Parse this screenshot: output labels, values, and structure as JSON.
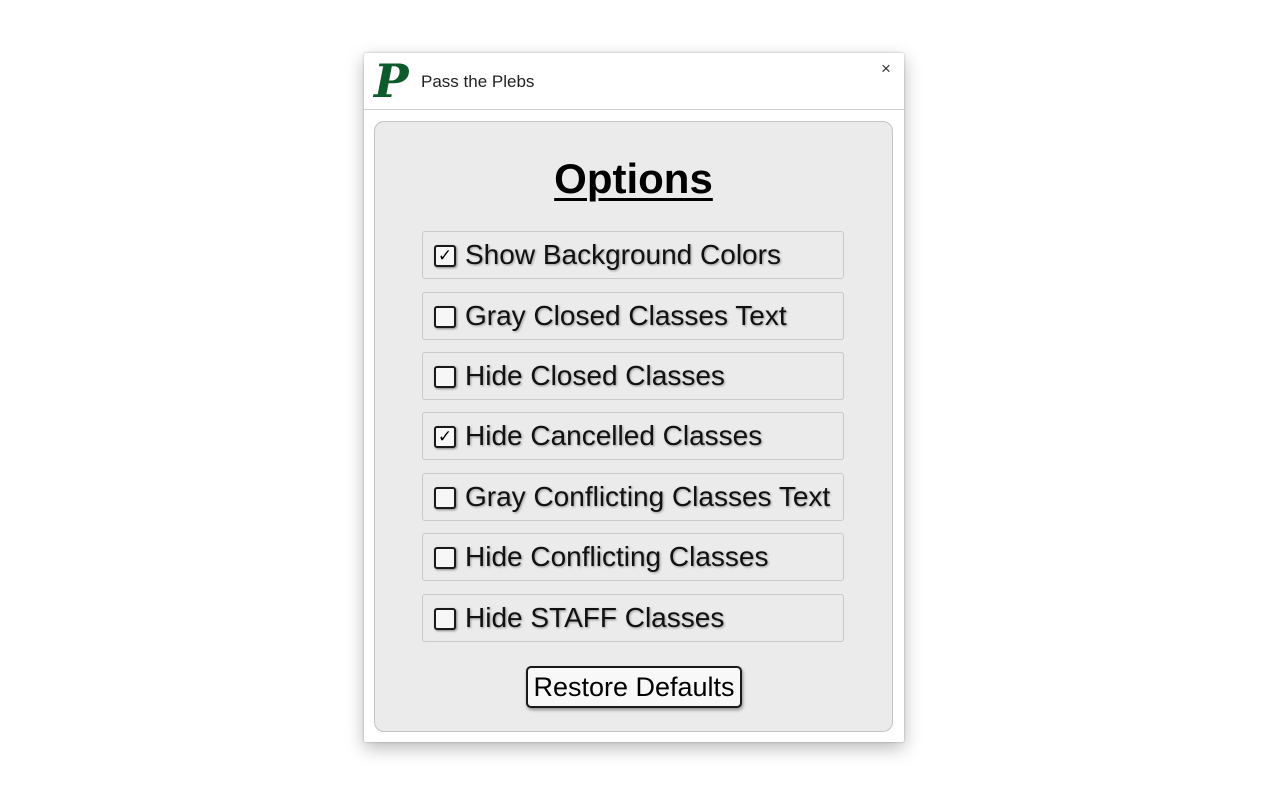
{
  "window": {
    "logo_letter": "P",
    "app_title": "Pass the Plebs",
    "close_label": "×"
  },
  "panel": {
    "title": "Options",
    "options": [
      {
        "label": "Show Background Colors",
        "checked": true,
        "mark": "✓"
      },
      {
        "label": "Gray Closed Classes Text",
        "checked": false,
        "mark": ""
      },
      {
        "label": "Hide Closed Classes",
        "checked": false,
        "mark": ""
      },
      {
        "label": "Hide Cancelled Classes",
        "checked": true,
        "mark": "✓"
      },
      {
        "label": "Gray Conflicting Classes Text",
        "checked": false,
        "mark": ""
      },
      {
        "label": "Hide Conflicting Classes",
        "checked": false,
        "mark": ""
      },
      {
        "label": "Hide STAFF Classes",
        "checked": false,
        "mark": ""
      }
    ],
    "restore_label": "Restore Defaults"
  },
  "colors": {
    "logo": "#0d5a2a",
    "panel_bg": "#ebebeb"
  }
}
